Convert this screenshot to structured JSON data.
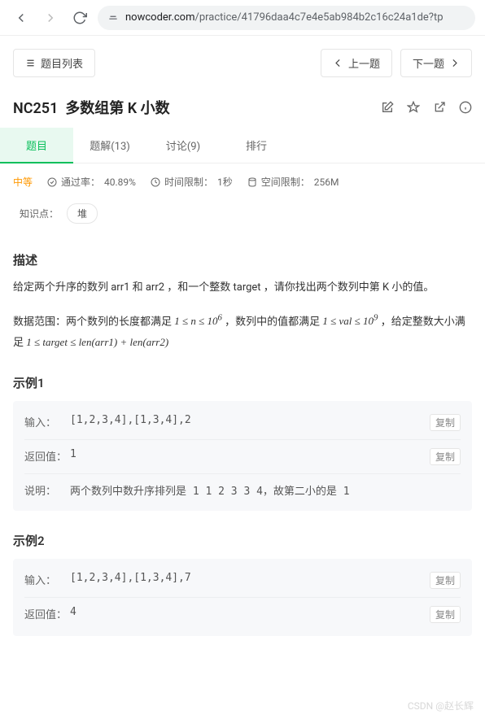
{
  "browser": {
    "url_prefix": "nowcoder.com",
    "url_rest": "/practice/41796daa4c7e4e5ab984b2c16c24a1de?tp"
  },
  "topbar": {
    "list_button": "题目列表",
    "prev_button": "上一题",
    "next_button": "下一题"
  },
  "problem": {
    "code": "NC251",
    "title": "多数组第 K 小数"
  },
  "tabs": {
    "t0": "题目",
    "t1": "题解(13)",
    "t2": "讨论(9)",
    "t3": "排行"
  },
  "meta": {
    "difficulty": "中等",
    "pass_rate_label": "通过率：",
    "pass_rate_value": "40.89%",
    "time_label": "时间限制：",
    "time_value": "1秒",
    "space_label": "空间限制：",
    "space_value": "256M"
  },
  "knowledge": {
    "label": "知识点：",
    "tag1": "堆"
  },
  "description": {
    "heading": "描述",
    "p1": "给定两个升序的数列 arr1 和 arr2 ，和一个整数 target ，请你找出两个数列中第 K 小的值。",
    "p2a": "数据范围：两个数列的长度都满足 ",
    "p2b": " ，数列中的值都满足 ",
    "p2c": " ，给定整数大小满足 ",
    "math1": "1 ≤ n ≤ 10",
    "math1_sup": "6",
    "math2": "1 ≤ val ≤ 10",
    "math2_sup": "9",
    "math3": "1 ≤ target ≤ len(arr1) + len(arr2)"
  },
  "examples": {
    "ex1_heading": "示例1",
    "ex2_heading": "示例2",
    "input_label": "输入：",
    "output_label": "返回值：",
    "explain_label": "说明：",
    "copy_label": "复制",
    "ex1_input": "[1,2,3,4],[1,3,4],2",
    "ex1_output": "1",
    "ex1_explain": "两个数列中数升序排列是  1  1  2  3  3  4，故第二小的是  1",
    "ex2_input": "[1,2,3,4],[1,3,4],7",
    "ex2_output": "4"
  },
  "watermark": "CSDN @赵长辉"
}
